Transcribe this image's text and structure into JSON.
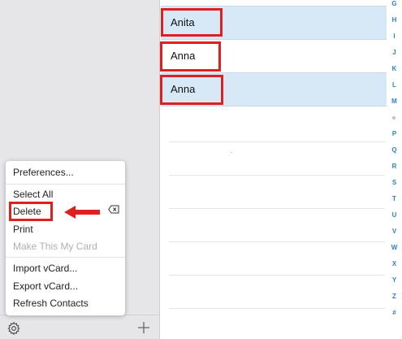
{
  "menu": {
    "preferences": "Preferences...",
    "select_all": "Select All",
    "delete": "Delete",
    "print": "Print",
    "make_my_card": "Make This My Card",
    "import_vcard": "Import vCard...",
    "export_vcard": "Export vCard...",
    "refresh_contacts": "Refresh Contacts"
  },
  "contacts": [
    {
      "name": "Anita",
      "selected": true
    },
    {
      "name": "Anna",
      "selected": false
    },
    {
      "name": "Anna",
      "selected": true
    }
  ],
  "alphabet_index": [
    "G",
    "H",
    "I",
    "J",
    "K",
    "L",
    "M",
    "•",
    "P",
    "Q",
    "R",
    "S",
    "T",
    "U",
    "V",
    "W",
    "X",
    "Y",
    "Z",
    "#"
  ],
  "icons": {
    "settings": "gear-icon",
    "add": "plus-icon",
    "backspace": "backspace-icon",
    "arrow": "arrow-left-icon"
  },
  "colors": {
    "highlight": "#e02020",
    "selection": "#d7e8f7",
    "index_accent": "#2e7fd6"
  }
}
